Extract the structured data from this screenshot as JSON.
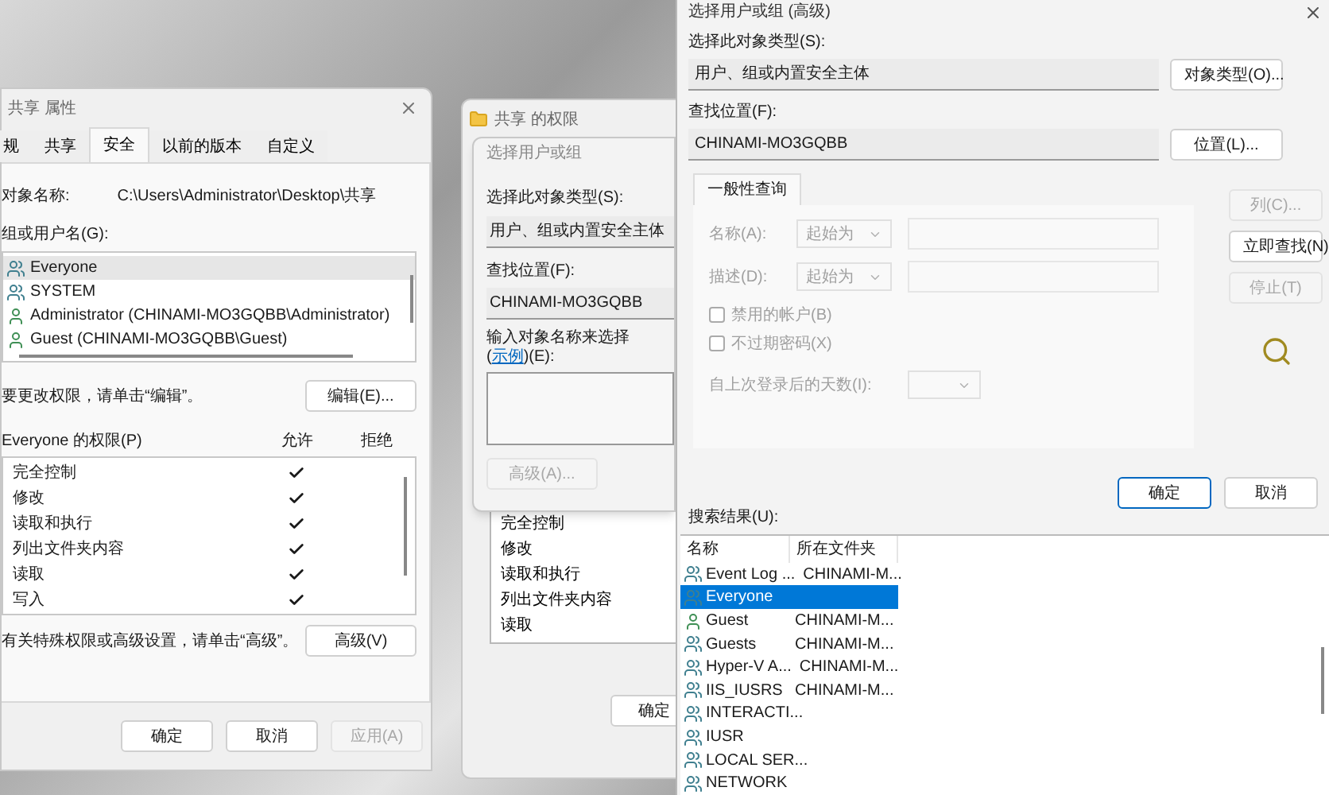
{
  "properties_window": {
    "title": "共享 属性",
    "tabs": [
      {
        "label": "规",
        "selected": false
      },
      {
        "label": "共享",
        "selected": false
      },
      {
        "label": "安全",
        "selected": true
      },
      {
        "label": "以前的版本",
        "selected": false
      },
      {
        "label": "自定义",
        "selected": false
      }
    ],
    "object_name_label": "对象名称:",
    "object_name_value": "C:\\Users\\Administrator\\Desktop\\共享",
    "groups_label": "组或用户名(G):",
    "groups": [
      {
        "name": "Everyone",
        "kind": "group",
        "selected": true
      },
      {
        "name": "SYSTEM",
        "kind": "group",
        "selected": false
      },
      {
        "name": "Administrator (CHINAMI-MO3GQBB\\Administrator)",
        "kind": "user",
        "selected": false
      },
      {
        "name": "Guest (CHINAMI-MO3GQBB\\Guest)",
        "kind": "user",
        "selected": false
      }
    ],
    "edit_hint": "要更改权限，请单击“编辑”。",
    "edit_button": "编辑(E)...",
    "permissions_label": "Everyone 的权限(P)",
    "allow_header": "允许",
    "deny_header": "拒绝",
    "permissions": [
      {
        "name": "完全控制",
        "allow": true,
        "deny": false
      },
      {
        "name": "修改",
        "allow": true,
        "deny": false
      },
      {
        "name": "读取和执行",
        "allow": true,
        "deny": false
      },
      {
        "name": "列出文件夹内容",
        "allow": true,
        "deny": false
      },
      {
        "name": "读取",
        "allow": true,
        "deny": false
      },
      {
        "name": "写入",
        "allow": true,
        "deny": false
      }
    ],
    "advanced_hint": "有关特殊权限或高级设置，请单击“高级”。",
    "advanced_button": "高级(V)",
    "buttons": [
      {
        "label": "确定",
        "disabled": false
      },
      {
        "label": "取消",
        "disabled": false
      },
      {
        "label": "应用(A)",
        "disabled": true
      }
    ]
  },
  "permissions_window": {
    "title": "共享 的权限",
    "permissions": [
      "完全控制",
      "修改",
      "读取和执行",
      "列出文件夹内容",
      "读取"
    ],
    "ok_button": "确定"
  },
  "select_dialog": {
    "title": "选择用户或组",
    "object_type_label": "选择此对象类型(S):",
    "object_type_value": "用户、组或内置安全主体",
    "location_label": "查找位置(F):",
    "location_value": "CHINAMI-MO3GQBB",
    "names_label_before": "输入对象名称来选择(",
    "names_link": "示例",
    "names_label_after": ")(E):",
    "advanced_button": {
      "label": "高级(A)...",
      "disabled": true
    }
  },
  "advanced_dialog": {
    "title": "选择用户或组 (高级)",
    "object_type_label": "选择此对象类型(S):",
    "object_type_value": "用户、组或内置安全主体",
    "object_type_button": "对象类型(O)...",
    "location_label": "查找位置(F):",
    "location_value": "CHINAMI-MO3GQBB",
    "location_button": "位置(L)...",
    "query_tab": "一般性查询",
    "name_label": "名称(A):",
    "name_mode": "起始为",
    "description_label": "描述(D):",
    "description_mode": "起始为",
    "checkboxes": [
      {
        "label": "禁用的帐户(B)",
        "checked": false
      },
      {
        "label": "不过期密码(X)",
        "checked": false
      }
    ],
    "days_label": "自上次登录后的天数(I):",
    "side_buttons": [
      {
        "label": "列(C)...",
        "disabled": true
      },
      {
        "label": "立即查找(N)",
        "disabled": false
      },
      {
        "label": "停止(T)",
        "disabled": true
      }
    ],
    "ok_button": "确定",
    "cancel_button": "取消",
    "results_label": "搜索结果(U):",
    "results_columns": [
      "名称",
      "所在文件夹"
    ],
    "results": [
      {
        "name": "Event Log ...",
        "folder": "CHINAMI-M...",
        "kind": "group",
        "selected": false
      },
      {
        "name": "Everyone",
        "kind": "group",
        "selected": true
      },
      {
        "name": "Guest",
        "folder": "CHINAMI-M...",
        "kind": "user",
        "selected": false
      },
      {
        "name": "Guests",
        "folder": "CHINAMI-M...",
        "kind": "group",
        "selected": false
      },
      {
        "name": "Hyper-V A...",
        "folder": "CHINAMI-M...",
        "kind": "group",
        "selected": false
      },
      {
        "name": "IIS_IUSRS",
        "folder": "CHINAMI-M...",
        "kind": "group",
        "selected": false
      },
      {
        "name": "INTERACTI...",
        "kind": "group",
        "selected": false
      },
      {
        "name": "IUSR",
        "kind": "group",
        "selected": false
      },
      {
        "name": "LOCAL SER...",
        "kind": "group",
        "selected": false
      },
      {
        "name": "NETWORK",
        "kind": "group",
        "selected": false
      }
    ]
  }
}
